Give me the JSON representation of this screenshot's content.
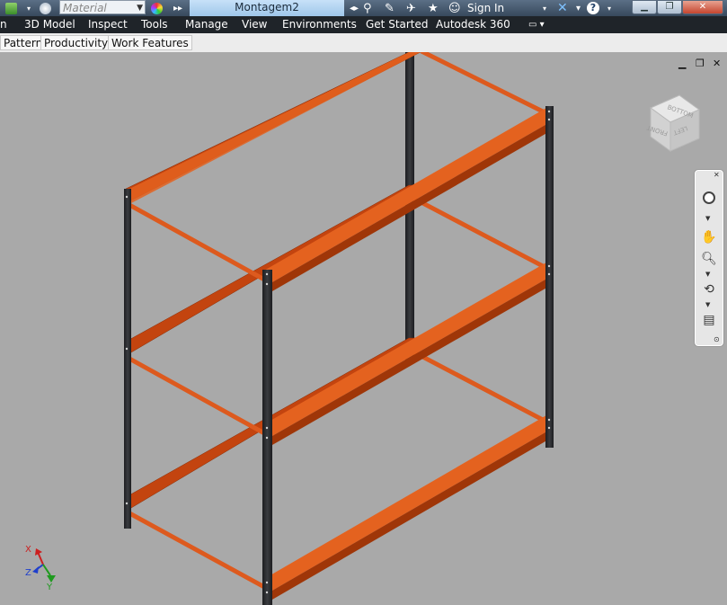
{
  "app": {
    "document_title": "Montagem2"
  },
  "quick_access": {
    "material_placeholder": "Material",
    "sign_in": "Sign In"
  },
  "menu": {
    "items": [
      "n",
      "3D Model",
      "Inspect",
      "Tools",
      "Manage",
      "View",
      "Environments",
      "Get Started",
      "Autodesk 360"
    ]
  },
  "sub_tabs": [
    "Pattern",
    "Productivity",
    "Work Features"
  ],
  "viewcube": {
    "faces": [
      "BOTTOM",
      "FRONT",
      "LEFT"
    ]
  },
  "axis_triad": {
    "x": "X",
    "y": "Y",
    "z": "Z"
  },
  "colors": {
    "beam": "#d9541c",
    "upright": "#2b2d30",
    "background": "#a9a9a9"
  },
  "icons": {
    "navbar": [
      "steering-wheel-icon",
      "pan-icon",
      "zoom-icon",
      "orbit-icon",
      "look-at-icon"
    ],
    "window": [
      "minimize-icon",
      "restore-icon",
      "close-icon"
    ]
  }
}
